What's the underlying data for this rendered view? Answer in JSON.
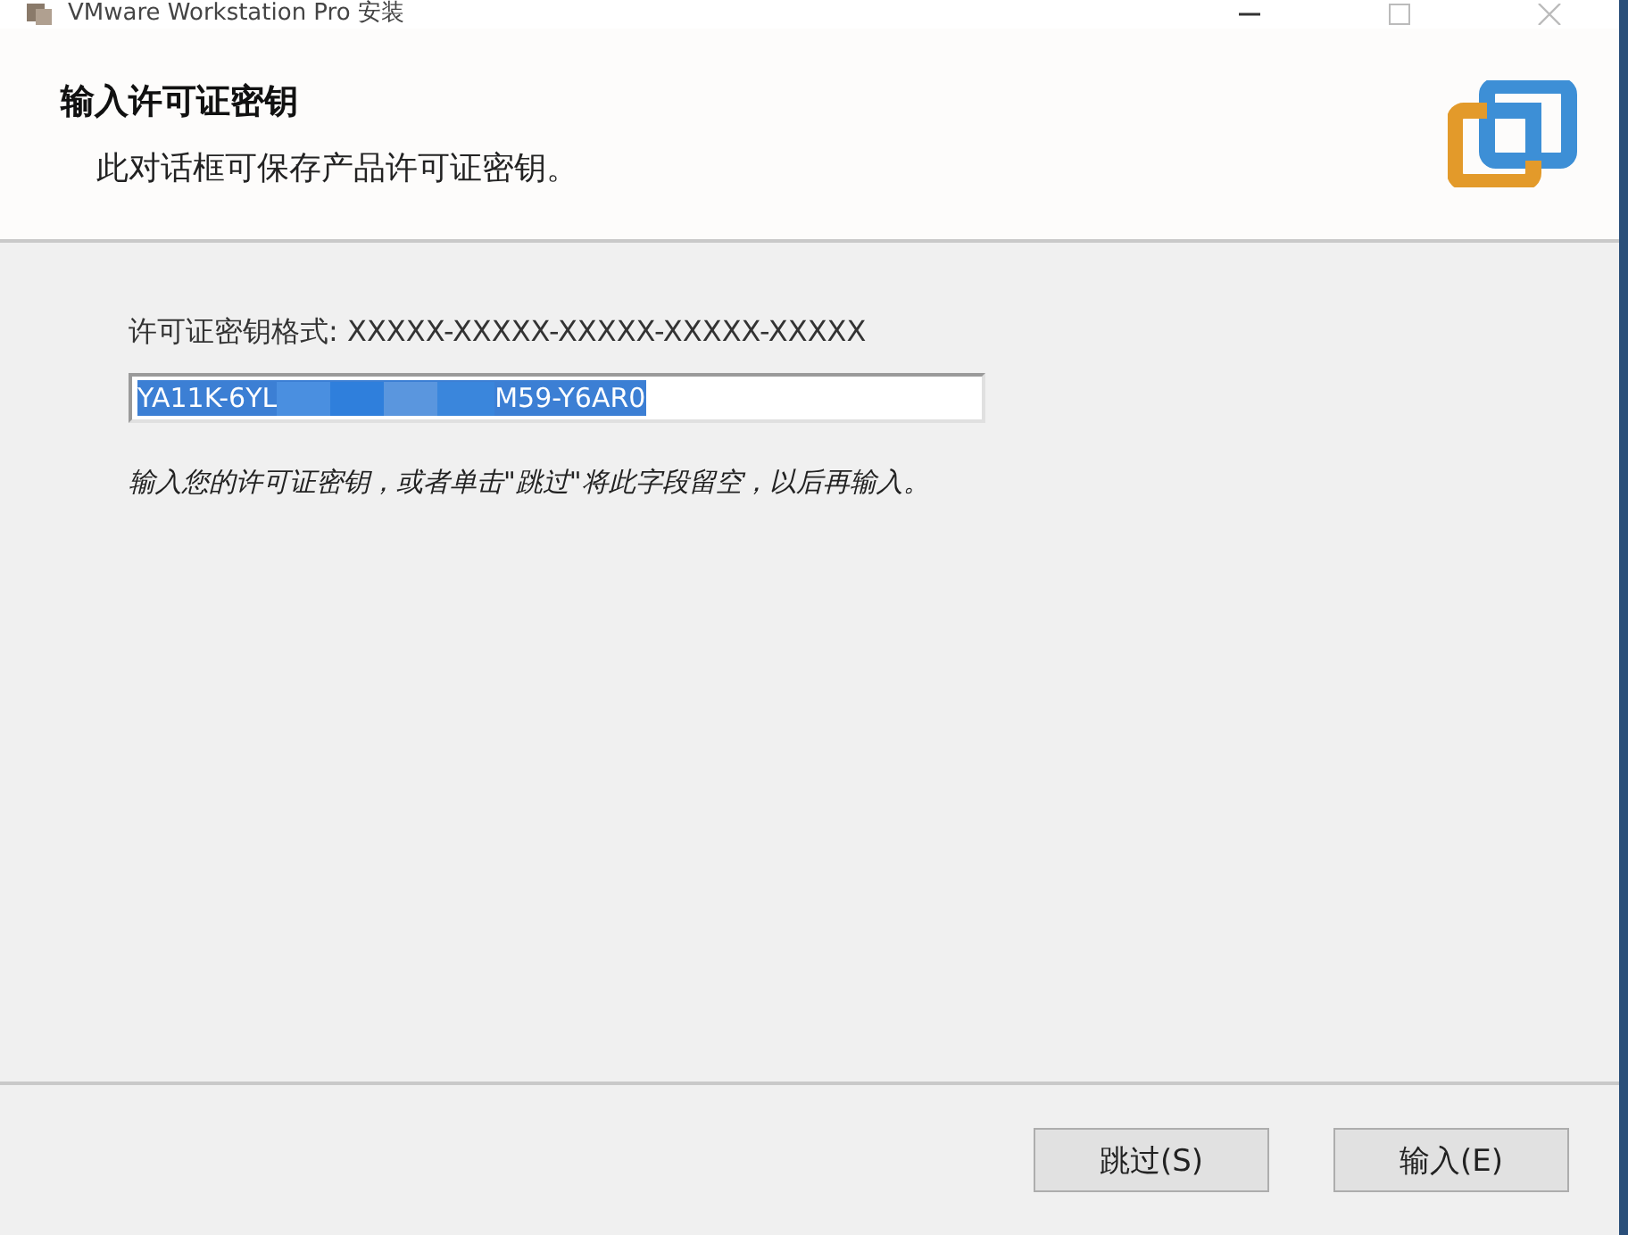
{
  "window": {
    "title": "VMware Workstation Pro 安装"
  },
  "header": {
    "title": "输入许可证密钥",
    "subtitle": "此对话框可保存产品许可证密钥。"
  },
  "license": {
    "format_label": "许可证密钥格式: XXXXX-XXXXX-XXXXX-XXXXX-XXXXX",
    "value_start": "YA11K-6YL",
    "value_end": "M59-Y6AR0",
    "redacted": true,
    "selected": true,
    "hint": "输入您的许可证密钥，或者单击\"跳过\"将此字段留空，以后再输入。"
  },
  "buttons": [
    {
      "label": "跳过(S)"
    },
    {
      "label": "输入(E)"
    }
  ]
}
